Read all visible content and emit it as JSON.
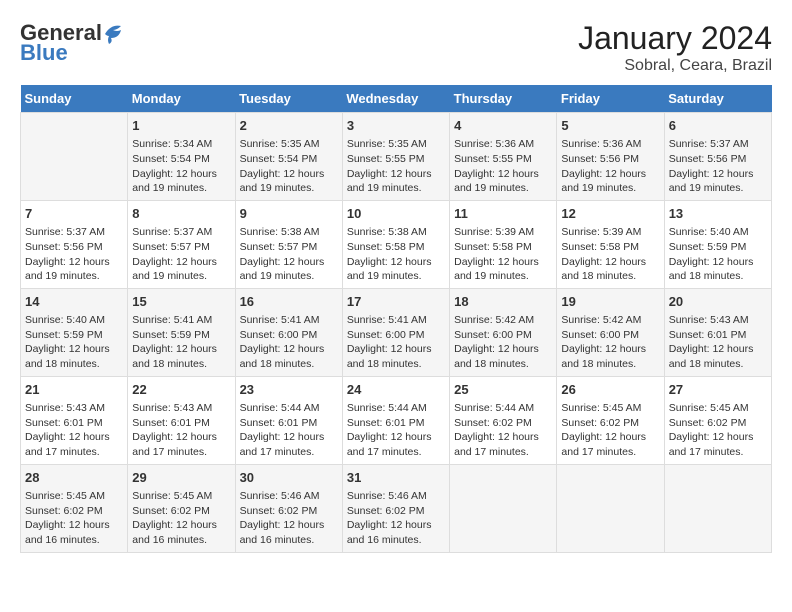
{
  "logo": {
    "line1": "General",
    "line2": "Blue"
  },
  "title": "January 2024",
  "subtitle": "Sobral, Ceara, Brazil",
  "calendar": {
    "headers": [
      "Sunday",
      "Monday",
      "Tuesday",
      "Wednesday",
      "Thursday",
      "Friday",
      "Saturday"
    ],
    "weeks": [
      [
        {
          "day": "",
          "info": ""
        },
        {
          "day": "1",
          "info": "Sunrise: 5:34 AM\nSunset: 5:54 PM\nDaylight: 12 hours\nand 19 minutes."
        },
        {
          "day": "2",
          "info": "Sunrise: 5:35 AM\nSunset: 5:54 PM\nDaylight: 12 hours\nand 19 minutes."
        },
        {
          "day": "3",
          "info": "Sunrise: 5:35 AM\nSunset: 5:55 PM\nDaylight: 12 hours\nand 19 minutes."
        },
        {
          "day": "4",
          "info": "Sunrise: 5:36 AM\nSunset: 5:55 PM\nDaylight: 12 hours\nand 19 minutes."
        },
        {
          "day": "5",
          "info": "Sunrise: 5:36 AM\nSunset: 5:56 PM\nDaylight: 12 hours\nand 19 minutes."
        },
        {
          "day": "6",
          "info": "Sunrise: 5:37 AM\nSunset: 5:56 PM\nDaylight: 12 hours\nand 19 minutes."
        }
      ],
      [
        {
          "day": "7",
          "info": "Sunrise: 5:37 AM\nSunset: 5:56 PM\nDaylight: 12 hours\nand 19 minutes."
        },
        {
          "day": "8",
          "info": "Sunrise: 5:37 AM\nSunset: 5:57 PM\nDaylight: 12 hours\nand 19 minutes."
        },
        {
          "day": "9",
          "info": "Sunrise: 5:38 AM\nSunset: 5:57 PM\nDaylight: 12 hours\nand 19 minutes."
        },
        {
          "day": "10",
          "info": "Sunrise: 5:38 AM\nSunset: 5:58 PM\nDaylight: 12 hours\nand 19 minutes."
        },
        {
          "day": "11",
          "info": "Sunrise: 5:39 AM\nSunset: 5:58 PM\nDaylight: 12 hours\nand 19 minutes."
        },
        {
          "day": "12",
          "info": "Sunrise: 5:39 AM\nSunset: 5:58 PM\nDaylight: 12 hours\nand 18 minutes."
        },
        {
          "day": "13",
          "info": "Sunrise: 5:40 AM\nSunset: 5:59 PM\nDaylight: 12 hours\nand 18 minutes."
        }
      ],
      [
        {
          "day": "14",
          "info": "Sunrise: 5:40 AM\nSunset: 5:59 PM\nDaylight: 12 hours\nand 18 minutes."
        },
        {
          "day": "15",
          "info": "Sunrise: 5:41 AM\nSunset: 5:59 PM\nDaylight: 12 hours\nand 18 minutes."
        },
        {
          "day": "16",
          "info": "Sunrise: 5:41 AM\nSunset: 6:00 PM\nDaylight: 12 hours\nand 18 minutes."
        },
        {
          "day": "17",
          "info": "Sunrise: 5:41 AM\nSunset: 6:00 PM\nDaylight: 12 hours\nand 18 minutes."
        },
        {
          "day": "18",
          "info": "Sunrise: 5:42 AM\nSunset: 6:00 PM\nDaylight: 12 hours\nand 18 minutes."
        },
        {
          "day": "19",
          "info": "Sunrise: 5:42 AM\nSunset: 6:00 PM\nDaylight: 12 hours\nand 18 minutes."
        },
        {
          "day": "20",
          "info": "Sunrise: 5:43 AM\nSunset: 6:01 PM\nDaylight: 12 hours\nand 18 minutes."
        }
      ],
      [
        {
          "day": "21",
          "info": "Sunrise: 5:43 AM\nSunset: 6:01 PM\nDaylight: 12 hours\nand 17 minutes."
        },
        {
          "day": "22",
          "info": "Sunrise: 5:43 AM\nSunset: 6:01 PM\nDaylight: 12 hours\nand 17 minutes."
        },
        {
          "day": "23",
          "info": "Sunrise: 5:44 AM\nSunset: 6:01 PM\nDaylight: 12 hours\nand 17 minutes."
        },
        {
          "day": "24",
          "info": "Sunrise: 5:44 AM\nSunset: 6:01 PM\nDaylight: 12 hours\nand 17 minutes."
        },
        {
          "day": "25",
          "info": "Sunrise: 5:44 AM\nSunset: 6:02 PM\nDaylight: 12 hours\nand 17 minutes."
        },
        {
          "day": "26",
          "info": "Sunrise: 5:45 AM\nSunset: 6:02 PM\nDaylight: 12 hours\nand 17 minutes."
        },
        {
          "day": "27",
          "info": "Sunrise: 5:45 AM\nSunset: 6:02 PM\nDaylight: 12 hours\nand 17 minutes."
        }
      ],
      [
        {
          "day": "28",
          "info": "Sunrise: 5:45 AM\nSunset: 6:02 PM\nDaylight: 12 hours\nand 16 minutes."
        },
        {
          "day": "29",
          "info": "Sunrise: 5:45 AM\nSunset: 6:02 PM\nDaylight: 12 hours\nand 16 minutes."
        },
        {
          "day": "30",
          "info": "Sunrise: 5:46 AM\nSunset: 6:02 PM\nDaylight: 12 hours\nand 16 minutes."
        },
        {
          "day": "31",
          "info": "Sunrise: 5:46 AM\nSunset: 6:02 PM\nDaylight: 12 hours\nand 16 minutes."
        },
        {
          "day": "",
          "info": ""
        },
        {
          "day": "",
          "info": ""
        },
        {
          "day": "",
          "info": ""
        }
      ]
    ]
  }
}
